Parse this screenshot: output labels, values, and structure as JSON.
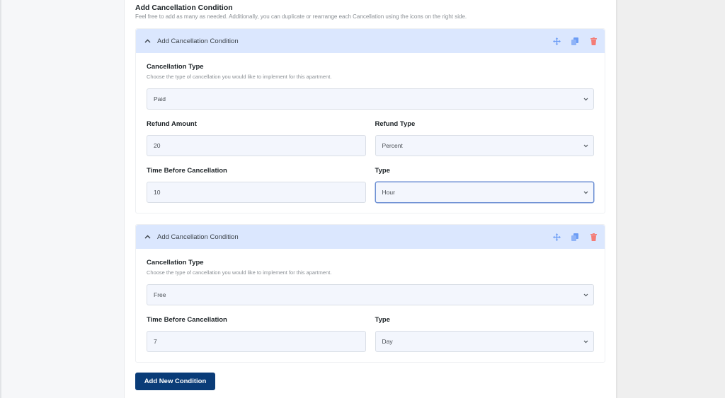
{
  "section": {
    "title": "Add Cancellation Condition",
    "description": "Feel free to add as many as needed. Additionally, you can duplicate or rearrange each Cancellation using the icons on the right side."
  },
  "colors": {
    "header_bg": "#dbe7fe",
    "move_icon": "#6b9cf5",
    "copy_icon": "#6b9cf5",
    "delete_icon": "#f47c76",
    "primary_button": "#0a3c78"
  },
  "conditions": [
    {
      "header_title": "Add Cancellation Condition",
      "icons": [
        "chevron-up-icon",
        "move-icon",
        "duplicate-icon",
        "trash-icon"
      ],
      "cancellation_type": {
        "label": "Cancellation Type",
        "help": "Choose the type of cancellation you would like to implement for this apartment.",
        "value": "Paid"
      },
      "refund_amount": {
        "label": "Refund Amount",
        "value": "20"
      },
      "refund_type": {
        "label": "Refund Type",
        "value": "Percent"
      },
      "time_before": {
        "label": "Time Before Cancellation",
        "value": "10"
      },
      "type": {
        "label": "Type",
        "value": "Hour"
      }
    },
    {
      "header_title": "Add Cancellation Condition",
      "icons": [
        "chevron-up-icon",
        "move-icon",
        "duplicate-icon",
        "trash-icon"
      ],
      "cancellation_type": {
        "label": "Cancellation Type",
        "help": "Choose the type of cancellation you would like to implement for this apartment.",
        "value": "Free"
      },
      "time_before": {
        "label": "Time Before Cancellation",
        "value": "7"
      },
      "type": {
        "label": "Type",
        "value": "Day"
      }
    }
  ],
  "add_button_label": "Add New Condition"
}
